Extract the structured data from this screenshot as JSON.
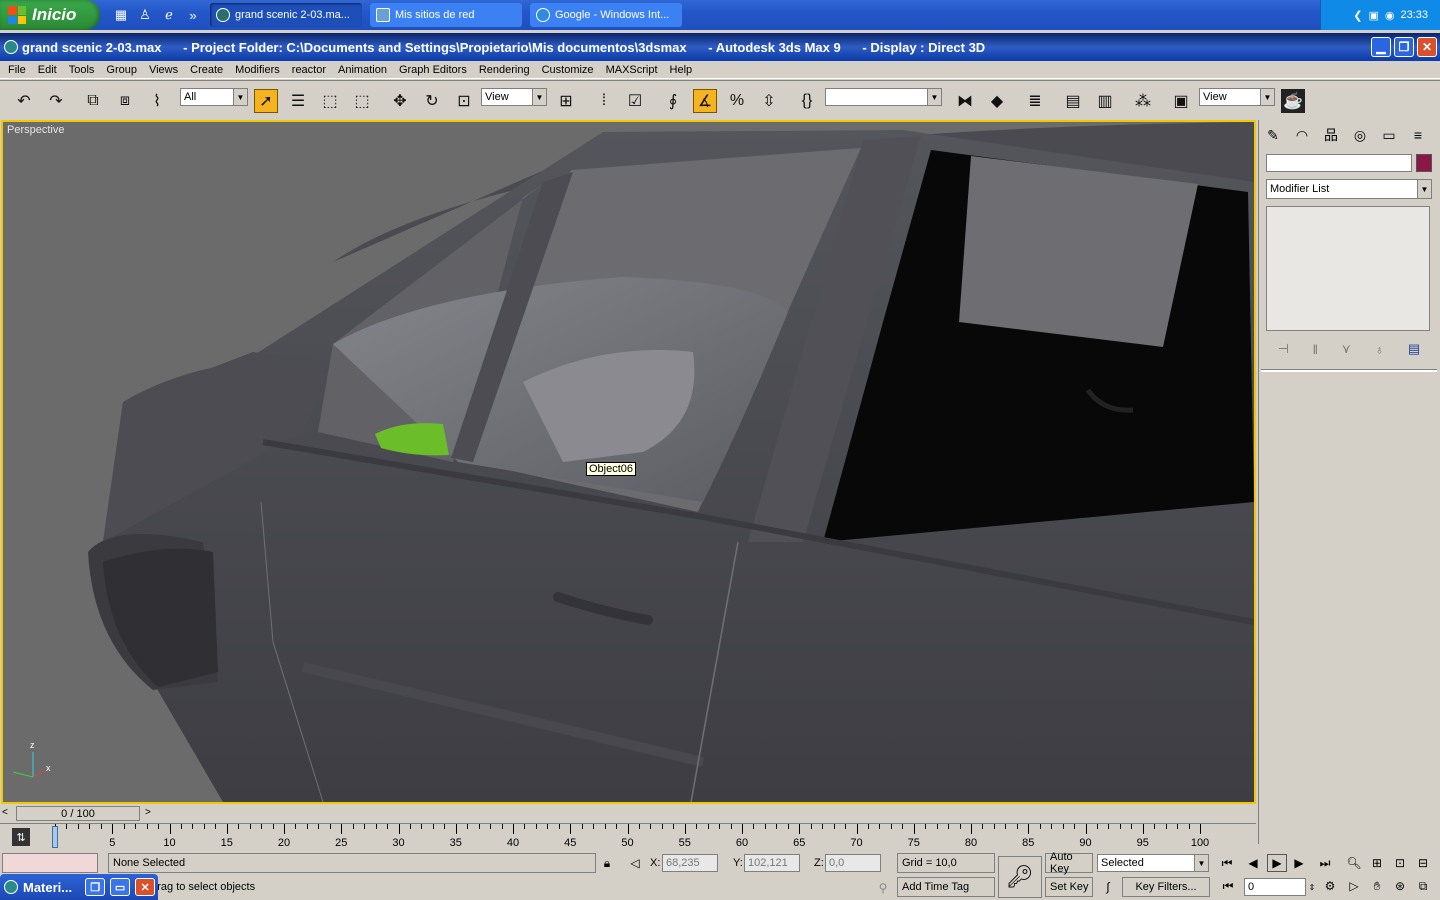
{
  "taskbar": {
    "start_label": "Inicio",
    "tasks": [
      {
        "label": "grand scenic 2-03.ma...",
        "active": true
      },
      {
        "label": "Mis sitios de red",
        "active": false
      },
      {
        "label": "Google - Windows Int...",
        "active": false
      }
    ],
    "clock": "23:33"
  },
  "window": {
    "title": "grand scenic 2-03.max      - Project Folder: C:\\Documents and Settings\\Propietario\\Mis documentos\\3dsmax      - Autodesk 3ds Max 9      - Display : Direct 3D"
  },
  "menu": [
    "File",
    "Edit",
    "Tools",
    "Group",
    "Views",
    "Create",
    "Modifiers",
    "reactor",
    "Animation",
    "Graph Editors",
    "Rendering",
    "Customize",
    "MAXScript",
    "Help"
  ],
  "toolbar": {
    "selection_filter": "All",
    "ref_coord": "View",
    "named_sets": "",
    "render_view": "View"
  },
  "viewport": {
    "label": "Perspective",
    "tooltip": "Object06",
    "axis_x": "x",
    "axis_z": "z"
  },
  "command_panel": {
    "object_name": "",
    "modifier_list": "Modifier List",
    "object_color": "#8a1846"
  },
  "time_slider": {
    "position_label": "0 / 100",
    "ticks": [
      "0",
      "5",
      "10",
      "15",
      "20",
      "25",
      "30",
      "35",
      "40",
      "45",
      "50",
      "55",
      "60",
      "65",
      "70",
      "75",
      "80",
      "85",
      "90",
      "95",
      "100"
    ]
  },
  "status": {
    "selection": "None Selected",
    "prompt": "ick-and-drag to select objects",
    "x_label": "X:",
    "x_value": "68,235",
    "y_label": "Y:",
    "y_value": "102,121",
    "z_label": "Z:",
    "z_value": "0,0",
    "grid": "Grid = 10,0",
    "add_time_tag": "Add Time Tag",
    "auto_key": "Auto Key",
    "set_key": "Set Key",
    "key_mode": "Selected",
    "key_filters": "Key Filters...",
    "frame": "0"
  },
  "floating_window": {
    "title": "Materi..."
  }
}
